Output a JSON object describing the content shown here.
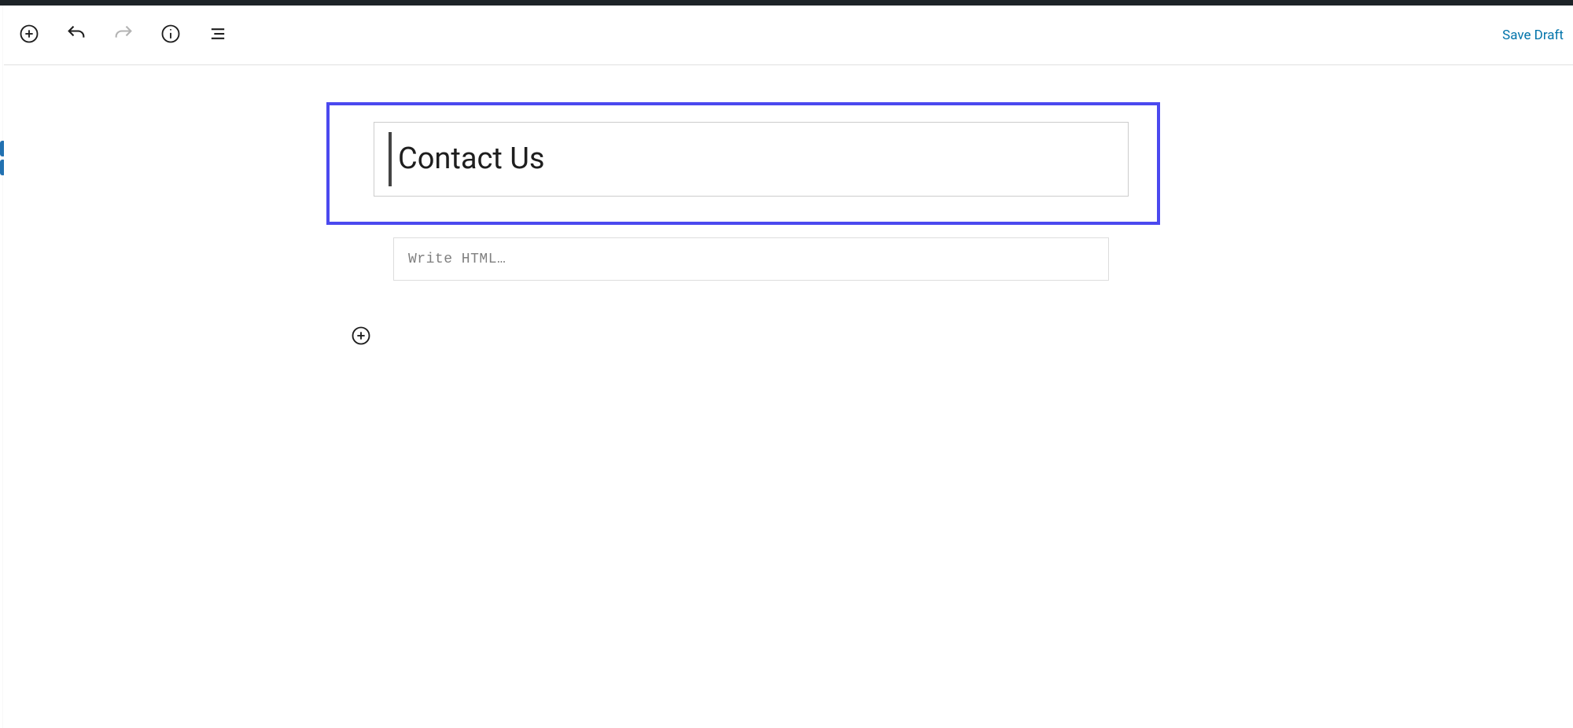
{
  "toolbar": {
    "save_draft_label": "Save Draft"
  },
  "editor": {
    "title_value": "Contact Us",
    "html_block_placeholder": "Write HTML…"
  }
}
